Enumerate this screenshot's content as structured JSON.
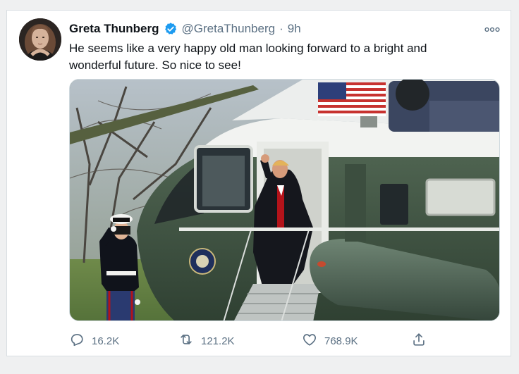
{
  "tweet": {
    "display_name": "Greta Thunberg",
    "handle": "@GretaThunberg",
    "separator": "·",
    "time": "9h",
    "text": "He seems like a very happy old man looking forward to a bright and wonderful future. So nice to see!",
    "verified_color": "#1d9bf0",
    "media_alt": "photo",
    "icons": {
      "avatar": "avatar",
      "verified": "verified-badge-icon",
      "more": "more-icon",
      "reply": "reply-icon",
      "retweet": "retweet-icon",
      "like": "like-icon",
      "share": "share-icon"
    },
    "actions": {
      "replies": "16.2K",
      "retweets": "121.2K",
      "likes": "768.9K"
    }
  }
}
